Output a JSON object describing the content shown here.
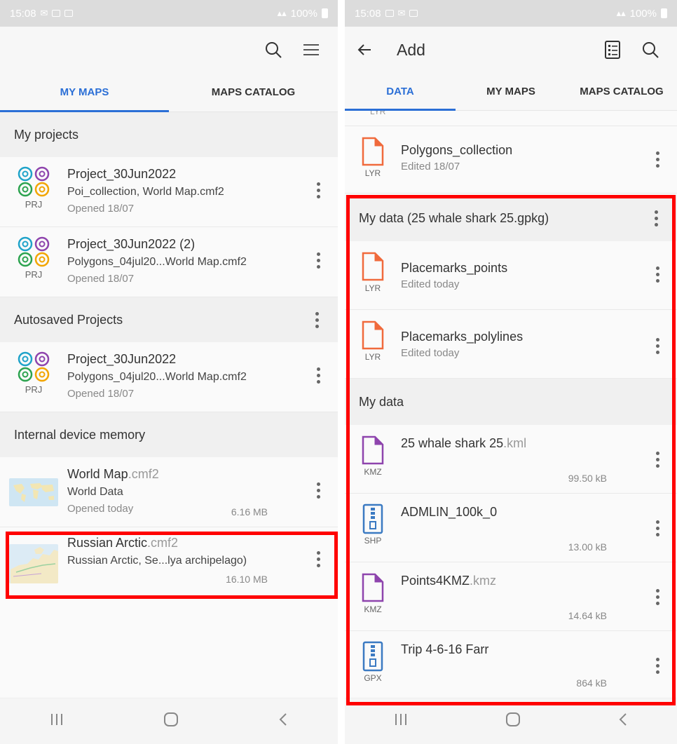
{
  "left": {
    "status": {
      "time": "15:08",
      "battery": "100%"
    },
    "tabs": [
      {
        "label": "MY MAPS"
      },
      {
        "label": "MAPS CATALOG"
      }
    ],
    "sections": {
      "my_projects": "My projects",
      "autosaved": "Autosaved Projects",
      "internal": "Internal device memory"
    },
    "projects": [
      {
        "title": "Project_30Jun2022",
        "subtitle": "Poi_collection, World Map.cmf2",
        "meta": "Opened 18/07",
        "type": "PRJ"
      },
      {
        "title": "Project_30Jun2022 (2)",
        "subtitle": "Polygons_04jul20...World Map.cmf2",
        "meta": "Opened 18/07",
        "type": "PRJ"
      }
    ],
    "autosaved": [
      {
        "title": "Project_30Jun2022",
        "subtitle": "Polygons_04jul20...World Map.cmf2",
        "meta": "Opened 18/07",
        "type": "PRJ"
      }
    ],
    "maps": [
      {
        "name": "World Map",
        "ext": ".cmf2",
        "subtitle": "World Data",
        "meta": "Opened today",
        "size": "6.16 MB"
      },
      {
        "name": "Russian Arctic",
        "ext": ".cmf2",
        "subtitle": "Russian Arctic, Se...lya archipelago)",
        "size": "16.10 MB"
      }
    ]
  },
  "right": {
    "status": {
      "time": "15:08",
      "battery": "100%"
    },
    "appbar": {
      "title": "Add"
    },
    "tabs": [
      {
        "label": "DATA"
      },
      {
        "label": "MY MAPS"
      },
      {
        "label": "MAPS CATALOG"
      }
    ],
    "partial_label": "LYR",
    "top_layer": {
      "title": "Polygons_collection",
      "meta": "Edited 18/07",
      "type": "LYR"
    },
    "gpkg_section": "My data (25 whale shark 25.gpkg)",
    "gpkg_layers": [
      {
        "title": "Placemarks_points",
        "meta": "Edited today",
        "type": "LYR"
      },
      {
        "title": "Placemarks_polylines",
        "meta": "Edited today",
        "type": "LYR"
      }
    ],
    "mydata_section": "My data",
    "files": [
      {
        "name": "25 whale shark 25",
        "ext": ".kml",
        "size": "99.50 kB",
        "type": "KMZ"
      },
      {
        "name": "ADMLIN_100k_0",
        "ext": "",
        "size": "13.00 kB",
        "type": "SHP"
      },
      {
        "name": "Points4KMZ",
        "ext": ".kmz",
        "size": "14.64 kB",
        "type": "KMZ"
      },
      {
        "name": "Trip 4-6-16 Farr",
        "ext": "",
        "size": "864 kB",
        "type": "GPX"
      }
    ]
  },
  "colors": {
    "accent": "#2b6fd6",
    "highlight": "#ff0000",
    "lyr": "#f06a3c",
    "kmz": "#8e44ad",
    "shp": "#3b7ac2"
  }
}
